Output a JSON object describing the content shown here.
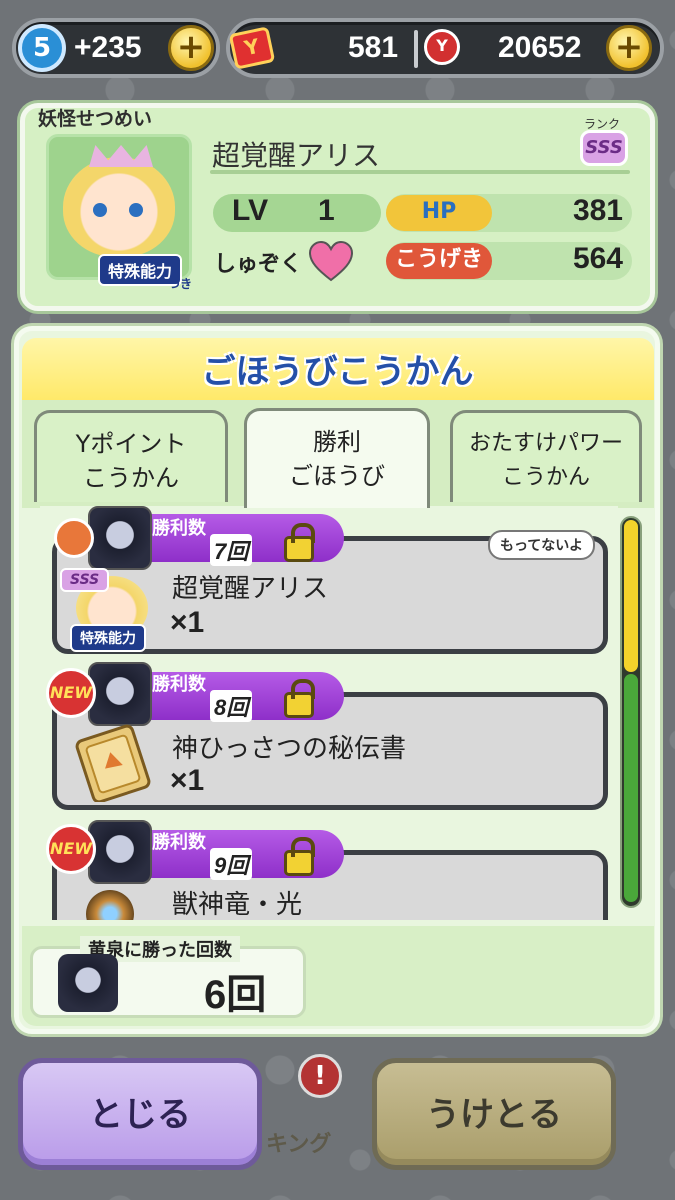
{
  "topbar": {
    "spirit_level": "5",
    "spirit_points": "+235",
    "tickets": "581",
    "medals": "20652",
    "plus_symbol": "+"
  },
  "info": {
    "heading": "妖怪せつめい",
    "character_name": "超覚醒アリス",
    "rank_label": "ランク",
    "rank": "SSS",
    "lv_label": "LV",
    "lv_value": "1",
    "hp_label": "HP",
    "hp_value": "381",
    "attack_label": "こうげき",
    "attack_value": "564",
    "tribe_label": "しゅぞく",
    "special_tag": "特殊能力",
    "special_sub": "つき"
  },
  "window": {
    "title": "ごほうびこうかん",
    "tabs": [
      {
        "line1": "Yポイント",
        "line2": "こうかん"
      },
      {
        "line1": "勝利",
        "line2": "ごほうび"
      },
      {
        "line1": "おたすけパワー",
        "line2": "こうかん"
      }
    ],
    "active_tab": 1
  },
  "rewards": [
    {
      "count_label": "勝利数",
      "count": "7回",
      "name": "超覚醒アリス",
      "qty": "×1",
      "badge": "flag",
      "status": "もってないよ",
      "rank": "SSS",
      "special_tag": "特殊能力"
    },
    {
      "count_label": "勝利数",
      "count": "8回",
      "name": "神ひっさつの秘伝書",
      "qty": "×1",
      "badge": "NEW"
    },
    {
      "count_label": "勝利数",
      "count": "9回",
      "name": "獣神竜・光",
      "qty": "",
      "badge": "NEW"
    }
  ],
  "scroll": {
    "position": 0.0
  },
  "footer": {
    "wins_label": "黄泉に勝った回数",
    "wins_value": "6回"
  },
  "buttons": {
    "close": "とじる",
    "receive": "うけとる"
  },
  "background": {
    "badge": "!",
    "partial_text": "キング"
  },
  "colors": {
    "info_bg": "#d6f0c4",
    "title_text": "#2450a8",
    "count_tag": "#9a3fd4",
    "close_button": "#c9b1ef",
    "receive_button": "#b8ac7e"
  }
}
